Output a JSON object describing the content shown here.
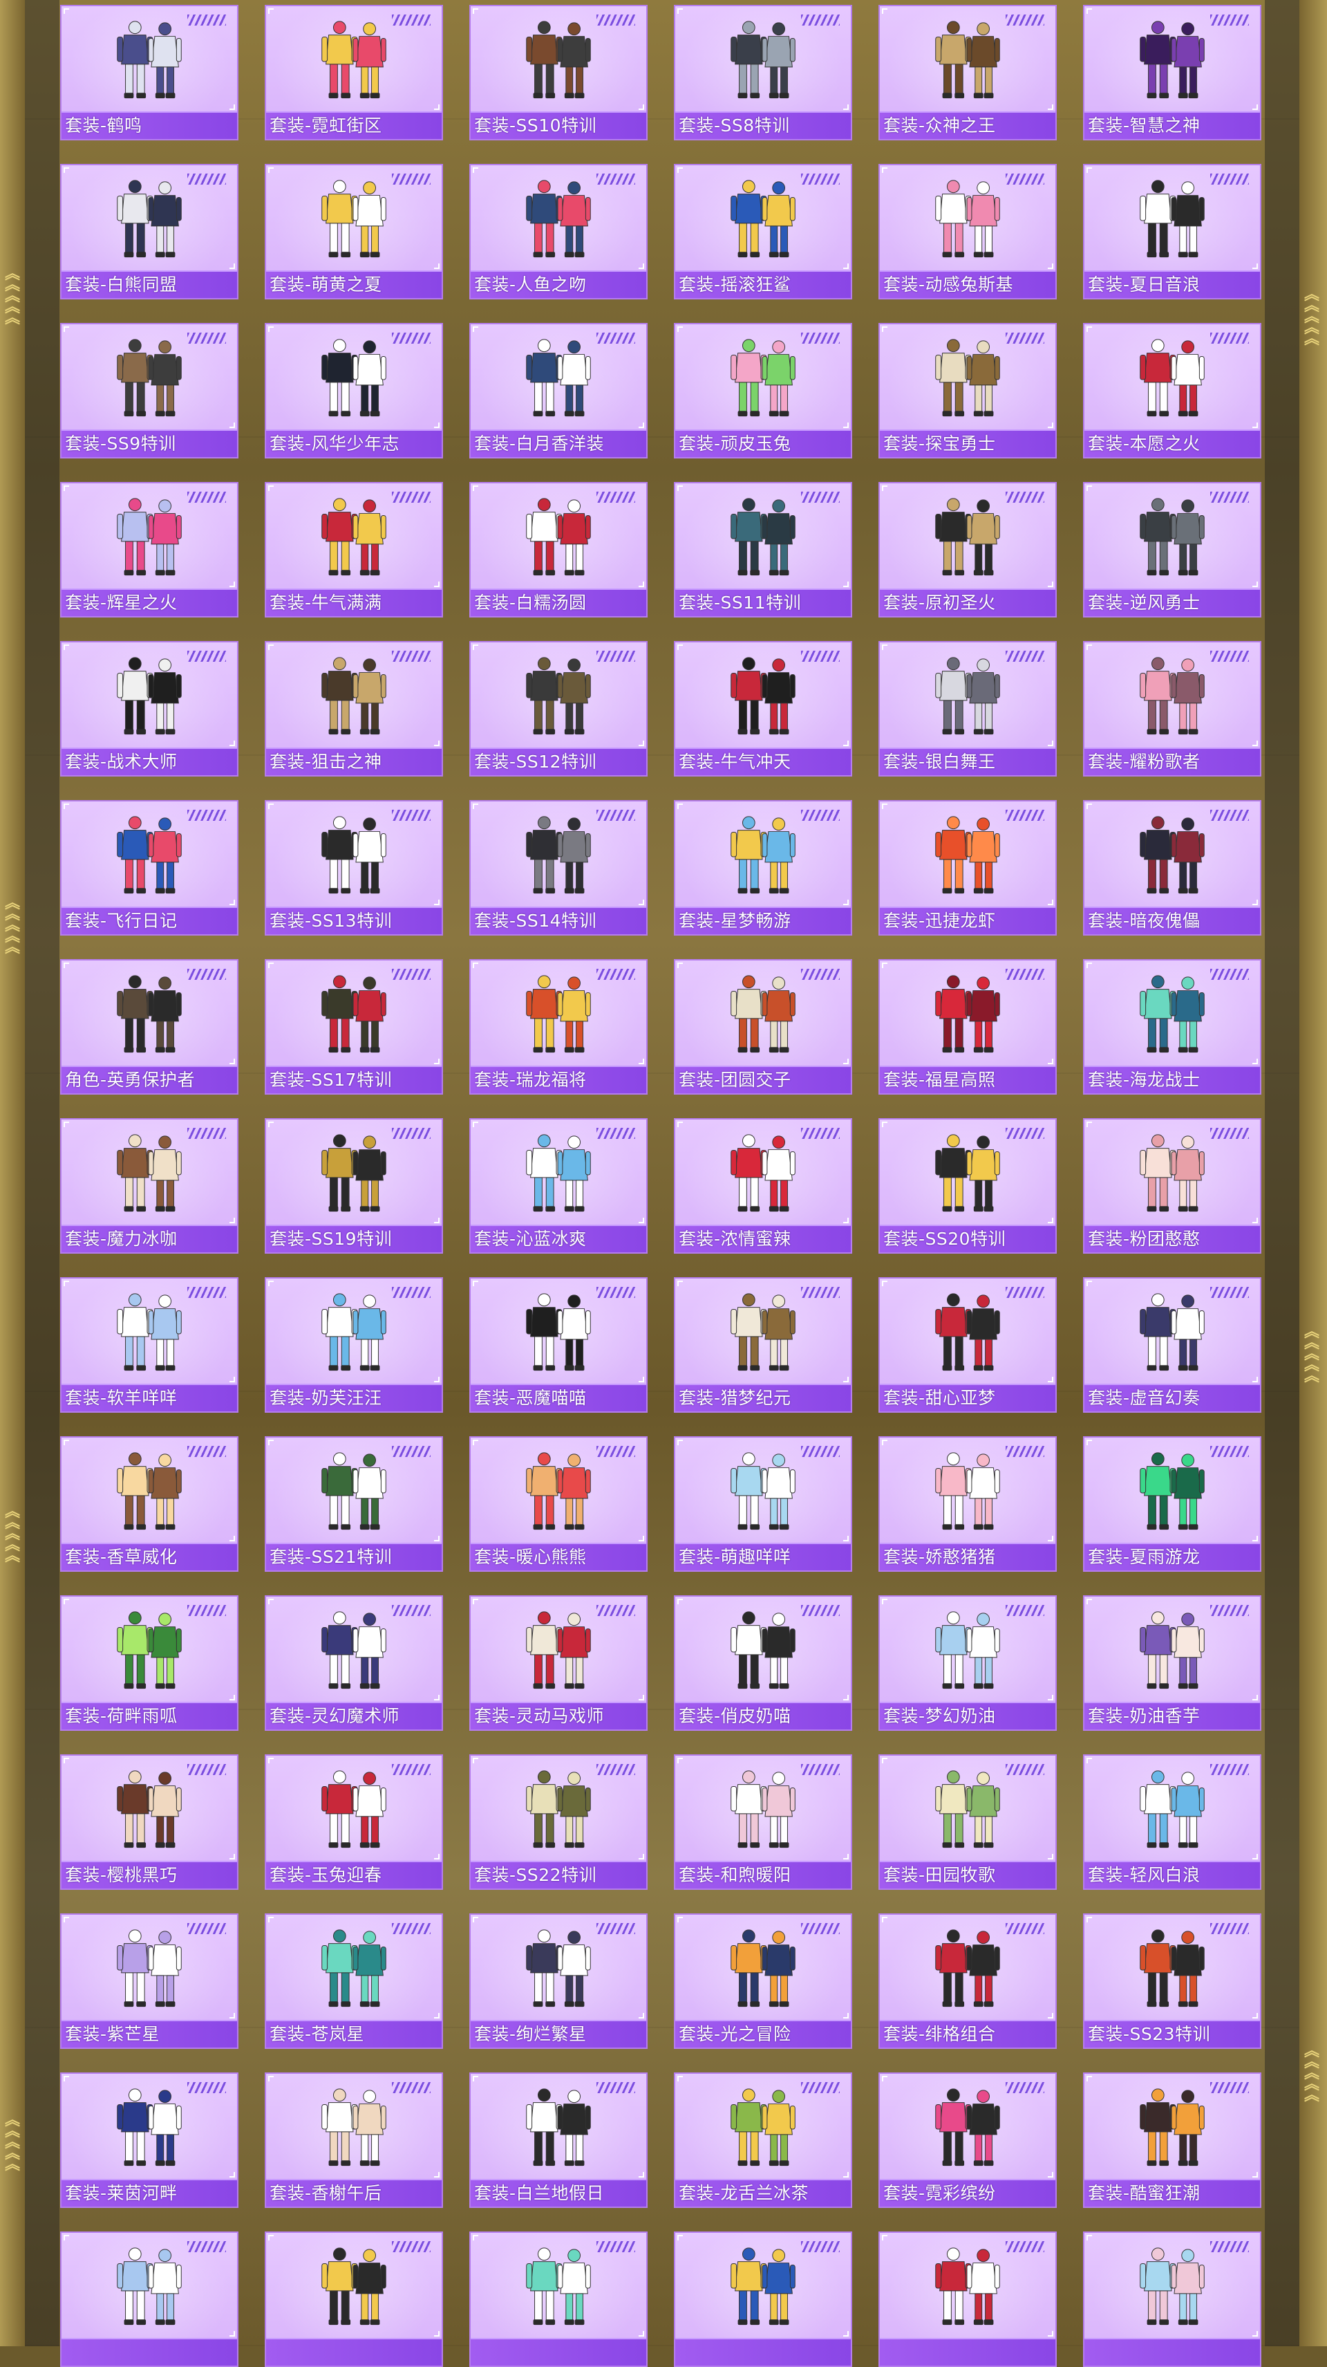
{
  "page": {
    "accent_color": "#a25cf0",
    "card_color": "#dfbdfd",
    "frame_color": "#b09a54"
  },
  "items": [
    {
      "label": "套装-鹤鸣",
      "colors": [
        "#4a4e8c",
        "#dfe2f0"
      ]
    },
    {
      "label": "套装-霓虹街区",
      "colors": [
        "#f2c94c",
        "#e84a6a"
      ]
    },
    {
      "label": "套装-SS10特训",
      "colors": [
        "#7a4a2e",
        "#3d3d3d"
      ]
    },
    {
      "label": "套装-SS8特训",
      "colors": [
        "#3a3f4a",
        "#9aa4b2"
      ]
    },
    {
      "label": "套装-众神之王",
      "colors": [
        "#c8a76b",
        "#6b4a2a"
      ]
    },
    {
      "label": "套装-智慧之神",
      "colors": [
        "#3a1d5c",
        "#7a3fb0"
      ]
    },
    {
      "label": "套装-白熊同盟",
      "colors": [
        "#e8e8ee",
        "#2f3552"
      ]
    },
    {
      "label": "套装-萌黄之夏",
      "colors": [
        "#f2c94c",
        "#ffffff"
      ]
    },
    {
      "label": "套装-人鱼之吻",
      "colors": [
        "#2f4a7a",
        "#e84a6a"
      ]
    },
    {
      "label": "套装-摇滚狂鲨",
      "colors": [
        "#2a5ab8",
        "#f2c94c"
      ]
    },
    {
      "label": "套装-动感兔斯基",
      "colors": [
        "#ffffff",
        "#f08ab0"
      ]
    },
    {
      "label": "套装-夏日音浪",
      "colors": [
        "#ffffff",
        "#2a2a2a"
      ]
    },
    {
      "label": "套装-SS9特训",
      "colors": [
        "#8a6a4a",
        "#3d3d3d"
      ]
    },
    {
      "label": "套装-风华少年志",
      "colors": [
        "#1f2430",
        "#ffffff"
      ]
    },
    {
      "label": "套装-白月香洋装",
      "colors": [
        "#2f4a7a",
        "#ffffff"
      ]
    },
    {
      "label": "套装-顽皮玉兔",
      "colors": [
        "#f4a6c8",
        "#7bd36a"
      ]
    },
    {
      "label": "套装-探宝勇士",
      "colors": [
        "#e8dcc0",
        "#8a6a3a"
      ]
    },
    {
      "label": "套装-本愿之火",
      "colors": [
        "#c8283a",
        "#ffffff"
      ]
    },
    {
      "label": "套装-辉星之火",
      "colors": [
        "#b8c0f0",
        "#e84a8a"
      ]
    },
    {
      "label": "套装-牛气满满",
      "colors": [
        "#c8283a",
        "#f2c94c"
      ]
    },
    {
      "label": "套装-白糯汤圆",
      "colors": [
        "#ffffff",
        "#c8283a"
      ]
    },
    {
      "label": "套装-SS11特训",
      "colors": [
        "#3a6a7a",
        "#2a3a44"
      ]
    },
    {
      "label": "套装-原初圣火",
      "colors": [
        "#2a2a2a",
        "#c8a76b"
      ]
    },
    {
      "label": "套装-逆风勇士",
      "colors": [
        "#3a3f44",
        "#6a7078"
      ]
    },
    {
      "label": "套装-战术大师",
      "colors": [
        "#f0f0f0",
        "#1f1f1f"
      ]
    },
    {
      "label": "套装-狙击之神",
      "colors": [
        "#4a3a2a",
        "#c8a76b"
      ]
    },
    {
      "label": "套装-SS12特训",
      "colors": [
        "#3a3a3a",
        "#6a5a3a"
      ]
    },
    {
      "label": "套装-牛气冲天",
      "colors": [
        "#c8283a",
        "#1f1f1f"
      ]
    },
    {
      "label": "套装-银白舞王",
      "colors": [
        "#d8d8e0",
        "#6a6a78"
      ]
    },
    {
      "label": "套装-耀粉歌者",
      "colors": [
        "#f0a0b8",
        "#8a5a6a"
      ]
    },
    {
      "label": "套装-飞行日记",
      "colors": [
        "#2a5ab8",
        "#e84a6a"
      ]
    },
    {
      "label": "套装-SS13特训",
      "colors": [
        "#2a2a2a",
        "#ffffff"
      ]
    },
    {
      "label": "套装-SS14特训",
      "colors": [
        "#2f2f34",
        "#7a7a82"
      ]
    },
    {
      "label": "套装-星梦畅游",
      "colors": [
        "#f2c94c",
        "#6ab8e8"
      ]
    },
    {
      "label": "套装-迅捷龙虾",
      "colors": [
        "#e8502a",
        "#ff8a4a"
      ]
    },
    {
      "label": "套装-暗夜傀儡",
      "colors": [
        "#2a2a3a",
        "#8a2a3a"
      ]
    },
    {
      "label": "角色-英勇保护者",
      "colors": [
        "#5a4a3a",
        "#2a2a2a"
      ]
    },
    {
      "label": "套装-SS17特训",
      "colors": [
        "#3a3a2a",
        "#c8283a"
      ]
    },
    {
      "label": "套装-瑞龙福将",
      "colors": [
        "#d8502a",
        "#f2c94c"
      ]
    },
    {
      "label": "套装-团圆交子",
      "colors": [
        "#e8e0c8",
        "#c8502a"
      ]
    },
    {
      "label": "套装-福星高照",
      "colors": [
        "#d8283a",
        "#8a1a2a"
      ]
    },
    {
      "label": "套装-海龙战士",
      "colors": [
        "#6ad8c0",
        "#2a6a8a"
      ]
    },
    {
      "label": "套装-魔力冰咖",
      "colors": [
        "#8a5a3a",
        "#f0e0c8"
      ]
    },
    {
      "label": "套装-SS19特训",
      "colors": [
        "#c8a03a",
        "#2a2a2a"
      ]
    },
    {
      "label": "套装-沁蓝冰爽",
      "colors": [
        "#ffffff",
        "#6ab8e8"
      ]
    },
    {
      "label": "套装-浓情蜜辣",
      "colors": [
        "#d8283a",
        "#ffffff"
      ]
    },
    {
      "label": "套装-SS20特训",
      "colors": [
        "#2a2a2a",
        "#f2c94c"
      ]
    },
    {
      "label": "套装-粉团憨憨",
      "colors": [
        "#f8e0d8",
        "#e8a0a8"
      ]
    },
    {
      "label": "套装-软羊咩咩",
      "colors": [
        "#ffffff",
        "#a8c8f0"
      ]
    },
    {
      "label": "套装-奶芙汪汪",
      "colors": [
        "#ffffff",
        "#6ab8e8"
      ]
    },
    {
      "label": "套装-恶魔喵喵",
      "colors": [
        "#1f1f1f",
        "#ffffff"
      ]
    },
    {
      "label": "套装-猎梦纪元",
      "colors": [
        "#f0e8d8",
        "#8a6a3a"
      ]
    },
    {
      "label": "套装-甜心亚梦",
      "colors": [
        "#c8283a",
        "#2a2a2a"
      ]
    },
    {
      "label": "套装-虚音幻奏",
      "colors": [
        "#3a3a6a",
        "#ffffff"
      ]
    },
    {
      "label": "套装-香草威化",
      "colors": [
        "#f8d8a0",
        "#8a5a3a"
      ]
    },
    {
      "label": "套装-SS21特训",
      "colors": [
        "#3a6a3a",
        "#ffffff"
      ]
    },
    {
      "label": "套装-暖心熊熊",
      "colors": [
        "#f0b070",
        "#e84a4a"
      ]
    },
    {
      "label": "套装-萌趣咩咩",
      "colors": [
        "#a8d8f0",
        "#ffffff"
      ]
    },
    {
      "label": "套装-娇憨猪猪",
      "colors": [
        "#f8b8c8",
        "#ffffff"
      ]
    },
    {
      "label": "套装-夏雨游龙",
      "colors": [
        "#3ad88a",
        "#1a6a4a"
      ]
    },
    {
      "label": "套装-荷畔雨呱",
      "colors": [
        "#a8e86a",
        "#3a8a3a"
      ]
    },
    {
      "label": "套装-灵幻魔术师",
      "colors": [
        "#3a3a7a",
        "#ffffff"
      ]
    },
    {
      "label": "套装-灵动马戏师",
      "colors": [
        "#f0e8d8",
        "#c8283a"
      ]
    },
    {
      "label": "套装-俏皮奶喵",
      "colors": [
        "#ffffff",
        "#2a2a2a"
      ]
    },
    {
      "label": "套装-梦幻奶油",
      "colors": [
        "#a8d0f0",
        "#ffffff"
      ]
    },
    {
      "label": "套装-奶油香芋",
      "colors": [
        "#7a5ab8",
        "#f8e8e0"
      ]
    },
    {
      "label": "套装-樱桃黑巧",
      "colors": [
        "#6a3a2a",
        "#f0d8c0"
      ]
    },
    {
      "label": "套装-玉兔迎春",
      "colors": [
        "#c8283a",
        "#ffffff"
      ]
    },
    {
      "label": "套装-SS22特训",
      "colors": [
        "#e8e0b8",
        "#6a6a3a"
      ]
    },
    {
      "label": "套装-和煦暖阳",
      "colors": [
        "#ffffff",
        "#f0c8d8"
      ]
    },
    {
      "label": "套装-田园牧歌",
      "colors": [
        "#f0e8c0",
        "#8ab86a"
      ]
    },
    {
      "label": "套装-轻风白浪",
      "colors": [
        "#ffffff",
        "#6ab8e8"
      ]
    },
    {
      "label": "套装-紫芒星",
      "colors": [
        "#b8a0e8",
        "#ffffff"
      ]
    },
    {
      "label": "套装-苍岚星",
      "colors": [
        "#6ad8c0",
        "#2a8a8a"
      ]
    },
    {
      "label": "套装-绚烂繁星",
      "colors": [
        "#3a3a5a",
        "#ffffff"
      ]
    },
    {
      "label": "套装-光之冒险",
      "colors": [
        "#f2a03a",
        "#2a3a6a"
      ]
    },
    {
      "label": "套装-绯格组合",
      "colors": [
        "#c8283a",
        "#2a2a2a"
      ]
    },
    {
      "label": "套装-SS23特训",
      "colors": [
        "#d8502a",
        "#2a2a2a"
      ]
    },
    {
      "label": "套装-莱茵河畔",
      "colors": [
        "#2a3a8a",
        "#ffffff"
      ]
    },
    {
      "label": "套装-香榭午后",
      "colors": [
        "#ffffff",
        "#f0d8c0"
      ]
    },
    {
      "label": "套装-白兰地假日",
      "colors": [
        "#ffffff",
        "#2a2a2a"
      ]
    },
    {
      "label": "套装-龙舌兰冰茶",
      "colors": [
        "#8ab84a",
        "#f2c94c"
      ]
    },
    {
      "label": "套装-霓彩缤纷",
      "colors": [
        "#e84a8a",
        "#2a2a2a"
      ]
    },
    {
      "label": "套装-酷蜜狂潮",
      "colors": [
        "#3a2a2a",
        "#f2a03a"
      ]
    },
    {
      "label": "",
      "colors": [
        "#a8c8f0",
        "#ffffff"
      ]
    },
    {
      "label": "",
      "colors": [
        "#f2c94c",
        "#2a2a2a"
      ]
    },
    {
      "label": "",
      "colors": [
        "#6ad8c0",
        "#ffffff"
      ]
    },
    {
      "label": "",
      "colors": [
        "#f2c94c",
        "#2a5ab8"
      ]
    },
    {
      "label": "",
      "colors": [
        "#c8283a",
        "#ffffff"
      ]
    },
    {
      "label": "",
      "colors": [
        "#a8d8f0",
        "#f0c8d8"
      ]
    }
  ]
}
